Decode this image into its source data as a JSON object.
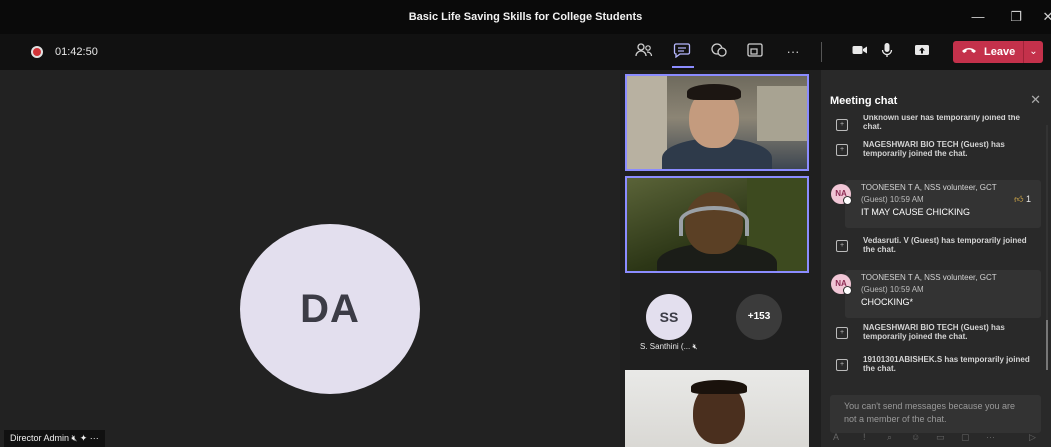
{
  "window": {
    "title": "Basic Life Saving Skills for College Students",
    "controls": {
      "minimize": "—",
      "maximize": "❐",
      "close": "✕"
    }
  },
  "toolbar": {
    "timer": "01:42:50",
    "icons": [
      "people-icon",
      "chat-icon",
      "reactions-icon",
      "rooms-icon",
      "more-icon",
      "camera-icon",
      "mic-icon",
      "share-icon"
    ],
    "more_glyph": "···",
    "leave_label": "Leave",
    "leave_caret": "⌄",
    "accent": "#8b8cff",
    "leave_color": "#c4314b"
  },
  "stage": {
    "main_initials": "DA",
    "main_name": "Director Admin"
  },
  "participants": {
    "ss_initials": "SS",
    "ss_name": "S. Santhini (...",
    "overflow_count": "+153"
  },
  "chat": {
    "title": "Meeting chat",
    "items": [
      {
        "kind": "system",
        "text": "Unknown user has temporarily joined the chat."
      },
      {
        "kind": "system",
        "text": "NAGESHWARI BIO TECH (Guest) has temporarily joined the chat."
      },
      {
        "kind": "message",
        "initials": "NA",
        "author": "TOONESEN T A, NSS volunteer, GCT",
        "time": "(Guest)   10:59 AM",
        "text": "IT MAY CAUSE CHICKING",
        "reaction_count": "1"
      },
      {
        "kind": "system",
        "text": "Vedasruti. V (Guest) has temporarily joined the chat."
      },
      {
        "kind": "message",
        "initials": "NA",
        "author": "TOONESEN T A, NSS volunteer, GCT",
        "time": "(Guest)   10:59 AM",
        "text": "CHOCKING*"
      },
      {
        "kind": "system",
        "text": "NAGESHWARI BIO TECH (Guest) has temporarily joined the chat."
      },
      {
        "kind": "system",
        "text": "19101301ABISHEK.S has temporarily joined the chat."
      }
    ],
    "notice": "You can't send messages because you are not a member of the chat."
  }
}
